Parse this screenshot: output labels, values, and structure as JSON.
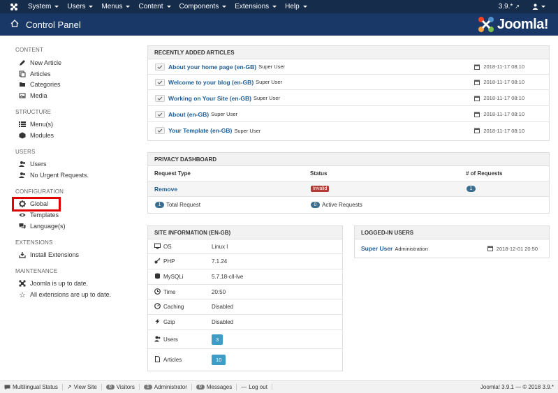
{
  "topnav": {
    "menus": [
      "System",
      "Users",
      "Menus",
      "Content",
      "Components",
      "Extensions",
      "Help"
    ],
    "version": "3.9.*"
  },
  "header": {
    "title": "Control Panel",
    "brand": "Joomla!"
  },
  "sidebar": {
    "sections": [
      {
        "title": "CONTENT",
        "items": [
          "New Article",
          "Articles",
          "Categories",
          "Media"
        ]
      },
      {
        "title": "STRUCTURE",
        "items": [
          "Menu(s)",
          "Modules"
        ]
      },
      {
        "title": "USERS",
        "items": [
          "Users",
          "No Urgent Requests."
        ]
      },
      {
        "title": "CONFIGURATION",
        "items": [
          "Global",
          "Templates",
          "Language(s)"
        ]
      },
      {
        "title": "EXTENSIONS",
        "items": [
          "Install Extensions"
        ]
      },
      {
        "title": "MAINTENANCE",
        "items": [
          "Joomla is up to date.",
          "All extensions are up to date."
        ]
      }
    ]
  },
  "recent": {
    "title": "RECENTLY ADDED ARTICLES",
    "rows": [
      {
        "title": "About your home page (en-GB)",
        "author": "Super User",
        "date": "2018-11-17 08:10"
      },
      {
        "title": "Welcome to your blog (en-GB)",
        "author": "Super User",
        "date": "2018-11-17 08:10"
      },
      {
        "title": "Working on Your Site (en-GB)",
        "author": "Super User",
        "date": "2018-11-17 08:10"
      },
      {
        "title": "About (en-GB)",
        "author": "Super User",
        "date": "2018-11-17 08:10"
      },
      {
        "title": "Your Template (en-GB)",
        "author": "Super User",
        "date": "2018-11-17 08:10"
      }
    ]
  },
  "privacy": {
    "title": "PRIVACY DASHBOARD",
    "col_type": "Request Type",
    "col_status": "Status",
    "col_count": "# of Requests",
    "row_type": "Remove",
    "row_status": "Invalid",
    "row_count": "1",
    "total_count": "1",
    "total_label": "Total Request",
    "active_count": "0",
    "active_label": "Active Requests"
  },
  "siteinfo": {
    "title": "SITE INFORMATION (EN-GB)",
    "rows": [
      {
        "label": "OS",
        "value": "Linux l"
      },
      {
        "label": "PHP",
        "value": "7.1.24"
      },
      {
        "label": "MySQLi",
        "value": "5.7.18-cll-lve"
      },
      {
        "label": "Time",
        "value": "20:50"
      },
      {
        "label": "Caching",
        "value": "Disabled"
      },
      {
        "label": "Gzip",
        "value": "Disabled"
      },
      {
        "label": "Users",
        "value": "3"
      },
      {
        "label": "Articles",
        "value": "10"
      }
    ]
  },
  "logged": {
    "title": "LOGGED-IN USERS",
    "user": "Super User",
    "role": "Administration",
    "date": "2018-12-01 20:50"
  },
  "status": {
    "multilingual": "Multilingual Status",
    "view_site": "View Site",
    "visitors_count": "0",
    "visitors": "Visitors",
    "admin_count": "1",
    "admin": "Administrator",
    "messages_count": "0",
    "messages": "Messages",
    "logout": "Log out",
    "version": "Joomla! 3.9.1 — © 2018 3.9.*"
  }
}
